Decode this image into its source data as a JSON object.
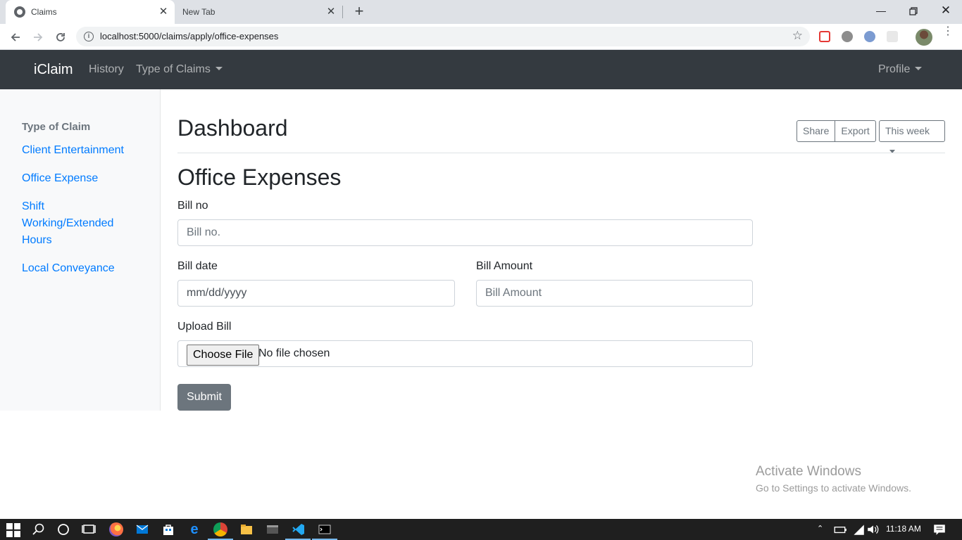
{
  "browser": {
    "tabs": [
      {
        "title": "Claims"
      },
      {
        "title": "New Tab"
      }
    ],
    "url": "localhost:5000/claims/apply/office-expenses"
  },
  "navbar": {
    "brand": "iClaim",
    "links": [
      "History",
      "Type of Claims"
    ],
    "profile": "Profile"
  },
  "sidebar": {
    "heading": "Type of Claim",
    "items": [
      {
        "label": "Client Entertainment"
      },
      {
        "label": "Office Expense"
      },
      {
        "label": "Shift Working/Extended Hours"
      },
      {
        "label": "Local Conveyance"
      }
    ]
  },
  "main": {
    "title": "Dashboard",
    "share_label": "Share",
    "export_label": "Export",
    "period_label": "This week",
    "form_title": "Office Expenses",
    "bill_no_label": "Bill no",
    "bill_no_placeholder": "Bill no.",
    "bill_date_label": "Bill date",
    "bill_date_placeholder": "mm/dd/yyyy",
    "bill_amount_label": "Bill Amount",
    "bill_amount_placeholder": "Bill Amount",
    "upload_label": "Upload Bill",
    "choose_file_label": "Choose File",
    "no_file_label": "No file chosen",
    "submit_label": "Submit"
  },
  "watermark": {
    "line1": "Activate Windows",
    "line2": "Go to Settings to activate Windows."
  },
  "taskbar": {
    "clock": "11:18 AM"
  }
}
